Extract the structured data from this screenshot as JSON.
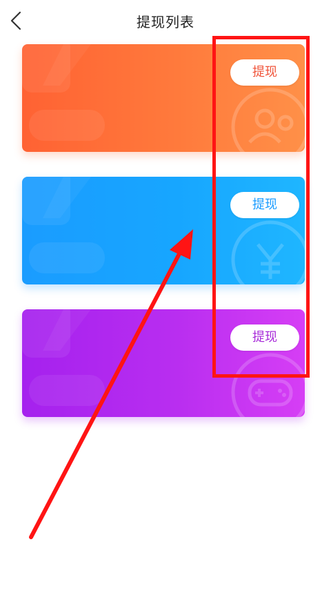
{
  "header": {
    "title": "提现列表",
    "back_icon": "chevron-left-icon"
  },
  "cards": [
    {
      "button_label": "提现",
      "color": "#ff6a36",
      "button_text_color": "#f0543a",
      "icon": "users-circle-icon"
    },
    {
      "button_label": "提现",
      "color": "#1aa2ff",
      "button_text_color": "#1a9cff",
      "icon": "yen-circle-icon"
    },
    {
      "button_label": "提现",
      "color": "#b52df0",
      "button_text_color": "#a82bd9",
      "icon": "gamepad-circle-icon"
    }
  ],
  "annotation": {
    "highlight_color": "#ff1414"
  }
}
